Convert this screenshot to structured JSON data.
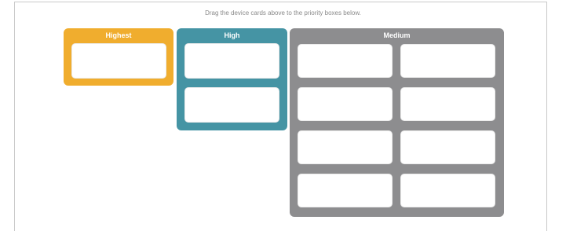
{
  "instruction": "Drag the device cards above to the priority boxes below.",
  "groups": {
    "highest": {
      "title": "Highest",
      "color": "#f0ad2e",
      "slots": 1
    },
    "high": {
      "title": "High",
      "color": "#4594a4",
      "slots": 2
    },
    "medium": {
      "title": "Medium",
      "color": "#8d8d8f",
      "slots": 8
    }
  }
}
